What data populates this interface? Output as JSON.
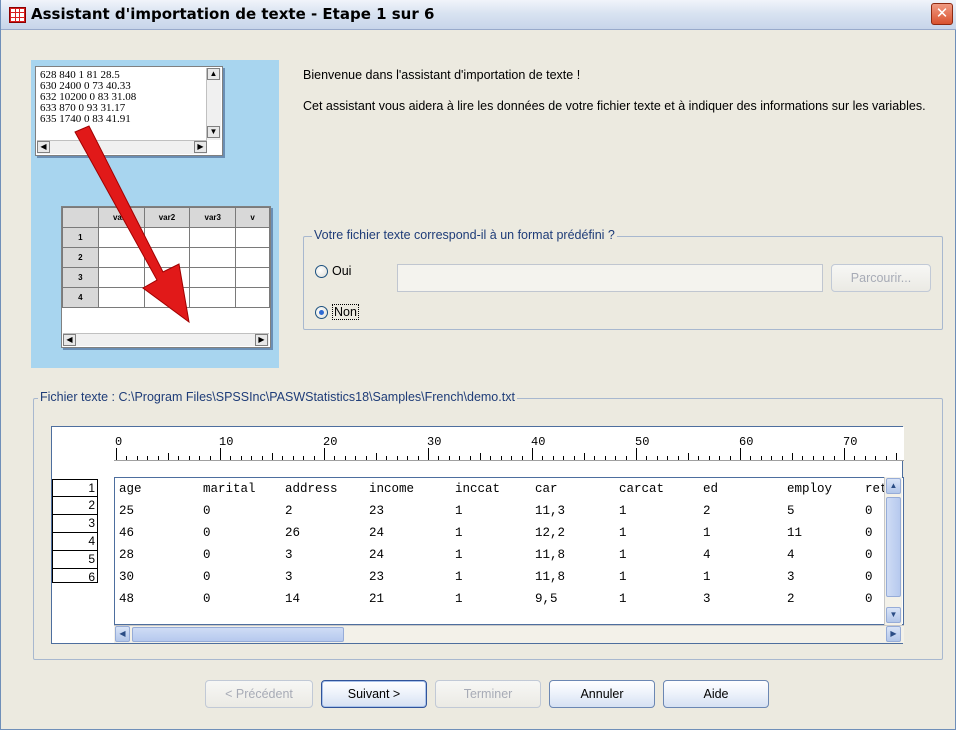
{
  "window": {
    "title": "Assistant d'importation de texte - Etape 1 sur 6",
    "close_glyph": "✕"
  },
  "illustration": {
    "text_lines": [
      "628 840 1 81 28.5",
      "630 2400 0 73 40.33",
      "632 10200 0 83 31.08",
      "633 870 0 93 31.17",
      "635 1740 0 83 41.91"
    ],
    "grid_columns": [
      "var1",
      "var2",
      "var3",
      "v"
    ],
    "grid_rows": [
      "1",
      "2",
      "3",
      "4"
    ]
  },
  "welcome": {
    "line1": "Bienvenue dans l'assistant d'importation de texte !",
    "line2": "Cet assistant vous aidera à lire les données de votre fichier texte et à indiquer des informations sur les variables."
  },
  "format_group": {
    "legend": "Votre fichier texte correspond-il à un format prédéfini ?",
    "option_yes": "Oui",
    "option_no": "Non",
    "selected": "Non",
    "path_value": "",
    "browse_label": "Parcourir..."
  },
  "file_group": {
    "legend": "Fichier texte :  C:\\Program Files\\SPSSInc\\PASWStatistics18\\Samples\\French\\demo.txt"
  },
  "ruler": {
    "labels": [
      "0",
      "10",
      "20",
      "30",
      "40",
      "50",
      "60",
      "70"
    ]
  },
  "preview": {
    "row_numbers": [
      "1",
      "2",
      "3",
      "4",
      "5",
      "6"
    ],
    "rows": [
      [
        "age",
        "marital",
        "address",
        "income",
        "inccat",
        "car",
        "carcat",
        "ed",
        "employ",
        "ret:"
      ],
      [
        "25",
        "0",
        "2",
        "23",
        "1",
        "11,3",
        "1",
        "2",
        "5",
        "0"
      ],
      [
        "46",
        "0",
        "26",
        "24",
        "1",
        "12,2",
        "1",
        "1",
        "11",
        "0"
      ],
      [
        "28",
        "0",
        "3",
        "24",
        "1",
        "11,8",
        "1",
        "4",
        "4",
        "0"
      ],
      [
        "30",
        "0",
        "3",
        "23",
        "1",
        "11,8",
        "1",
        "1",
        "3",
        "0"
      ],
      [
        "48",
        "0",
        "14",
        "21",
        "1",
        "9,5",
        "1",
        "3",
        "2",
        "0"
      ]
    ]
  },
  "buttons": {
    "previous": "< Précédent",
    "next": "Suivant >",
    "finish": "Terminer",
    "cancel": "Annuler",
    "help": "Aide"
  }
}
